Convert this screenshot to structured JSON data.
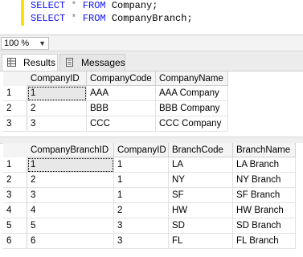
{
  "editor": {
    "line1": {
      "kw1": "SELECT",
      "star": "*",
      "kw2": "FROM",
      "table": "Company;"
    },
    "line2": {
      "kw1": "SELECT",
      "star": "*",
      "kw2": "FROM",
      "table": "CompanyBranch;"
    }
  },
  "zoom": {
    "value": "100 %"
  },
  "tabs": [
    {
      "label": "Results",
      "icon": "grid-icon"
    },
    {
      "label": "Messages",
      "icon": "messages-icon"
    }
  ],
  "grid1": {
    "columns": [
      "CompanyID",
      "CompanyCode",
      "CompanyName"
    ],
    "rows": [
      {
        "num": "1",
        "cells": [
          "1",
          "AAA",
          "AAA Company"
        ]
      },
      {
        "num": "2",
        "cells": [
          "2",
          "BBB",
          "BBB Company"
        ]
      },
      {
        "num": "3",
        "cells": [
          "3",
          "CCC",
          "CCC Company"
        ]
      }
    ]
  },
  "grid2": {
    "columns": [
      "CompanyBranchID",
      "CompanyID",
      "BranchCode",
      "BranchName"
    ],
    "rows": [
      {
        "num": "1",
        "cells": [
          "1",
          "1",
          "LA",
          "LA Branch"
        ]
      },
      {
        "num": "2",
        "cells": [
          "2",
          "1",
          "NY",
          "NY Branch"
        ]
      },
      {
        "num": "3",
        "cells": [
          "3",
          "1",
          "SF",
          "SF Branch"
        ]
      },
      {
        "num": "4",
        "cells": [
          "4",
          "2",
          "HW",
          "HW Branch"
        ]
      },
      {
        "num": "5",
        "cells": [
          "5",
          "3",
          "SD",
          "SD Branch"
        ]
      },
      {
        "num": "6",
        "cells": [
          "6",
          "3",
          "FL",
          "FL Branch"
        ]
      }
    ]
  }
}
